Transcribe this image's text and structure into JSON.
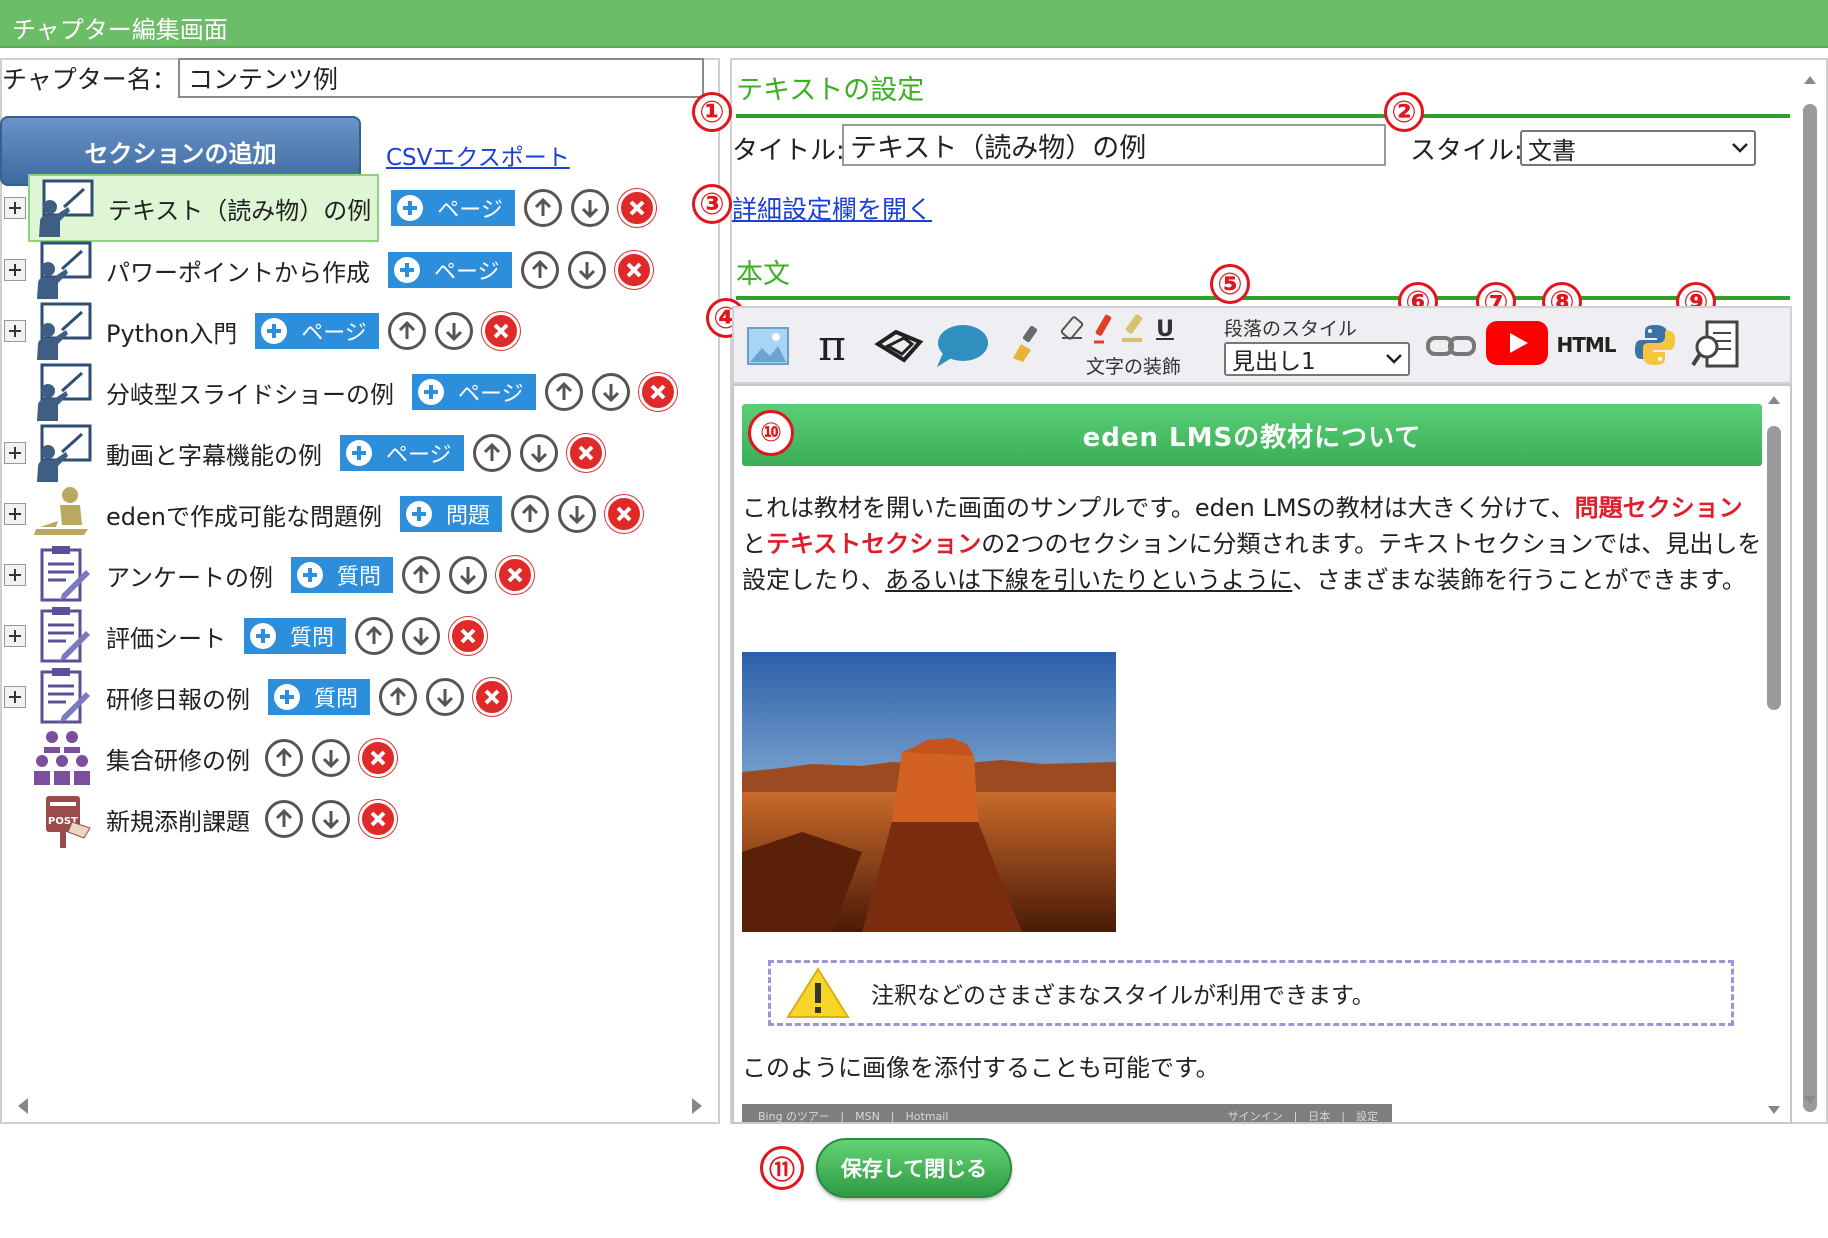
{
  "window": {
    "title": "チャプター編集画面"
  },
  "chapter": {
    "label": "チャプター名：",
    "value": "コンテンツ例"
  },
  "left": {
    "add_section_label": "セクションの追加",
    "csv_export_label": "CSVエクスポート",
    "items": [
      {
        "label": "テキスト（読み物）の例",
        "icon": "teacher-board-icon",
        "badge": "ページ",
        "expandable": true,
        "selected": true
      },
      {
        "label": "パワーポイントから作成",
        "icon": "teacher-board-icon",
        "badge": "ページ",
        "expandable": true
      },
      {
        "label": "Python入門",
        "icon": "teacher-board-icon",
        "badge": "ページ",
        "expandable": true
      },
      {
        "label": "分岐型スライドショーの例",
        "icon": "teacher-board-icon",
        "badge": "ページ",
        "expandable": false
      },
      {
        "label": "動画と字幕機能の例",
        "icon": "teacher-board-icon",
        "badge": "ページ",
        "expandable": true
      },
      {
        "label": "edenで作成可能な問題例",
        "icon": "student-desk-icon",
        "badge": "問題",
        "expandable": true
      },
      {
        "label": "アンケートの例",
        "icon": "clipboard-icon",
        "badge": "質問",
        "expandable": true
      },
      {
        "label": "評価シート",
        "icon": "clipboard-icon",
        "badge": "質問",
        "expandable": true
      },
      {
        "label": "研修日報の例",
        "icon": "clipboard-icon",
        "badge": "質問",
        "expandable": true
      },
      {
        "label": "集合研修の例",
        "icon": "group-training-icon",
        "badge": "",
        "expandable": false
      },
      {
        "label": "新規添削課題",
        "icon": "post-box-icon",
        "badge": "",
        "expandable": false
      }
    ]
  },
  "right": {
    "text_settings_heading": "テキストの設定",
    "title_label": "タイトル:",
    "title_value": "テキスト（読み物）の例",
    "style_label": "スタイル:",
    "style_value": "文書",
    "detail_link": "詳細設定欄を開く",
    "body_heading": "本文",
    "toolbar": {
      "paragraph_style_label": "段落のスタイル",
      "paragraph_style_value": "見出し1",
      "text_decoration_label": "文字の装飾",
      "underline_glyph": "U",
      "html_label": "HTML"
    },
    "callouts": [
      "①",
      "②",
      "③",
      "④",
      "⑤",
      "⑥",
      "⑦",
      "⑧",
      "⑨",
      "⑩",
      "⑪"
    ]
  },
  "editor": {
    "heading": "eden LMSの教材について",
    "p1_a": "これは教材を開いた画面のサンプルです。eden LMSの教材は大きく分けて、",
    "p1_red1": "問題セクション",
    "p1_b": "と",
    "p1_red2": "テキストセクション",
    "p1_c": "の2つのセクションに分類されます。テキストセクションでは、見出しを設定したり、",
    "p1_ul": "あるいは下線を引いたりというように",
    "p1_d": "、さまざまな装飾を行うことができます。",
    "note": "注釈などのさまざまなスタイルが利用できます。",
    "p2": "このように画像を添付することも可能です。",
    "strip_left": "Bing のツアー　|　MSN　|　Hotmail",
    "strip_right": "サインイン　|　日本　|　設定"
  },
  "footer": {
    "save_label": "保存して閉じる"
  },
  "colors": {
    "titlebar": "#6bbd68",
    "accent_green": "#3cb022",
    "badge_blue": "#2d8fdc",
    "delete_red": "#e02a2a",
    "callout_red": "#e3141b"
  }
}
